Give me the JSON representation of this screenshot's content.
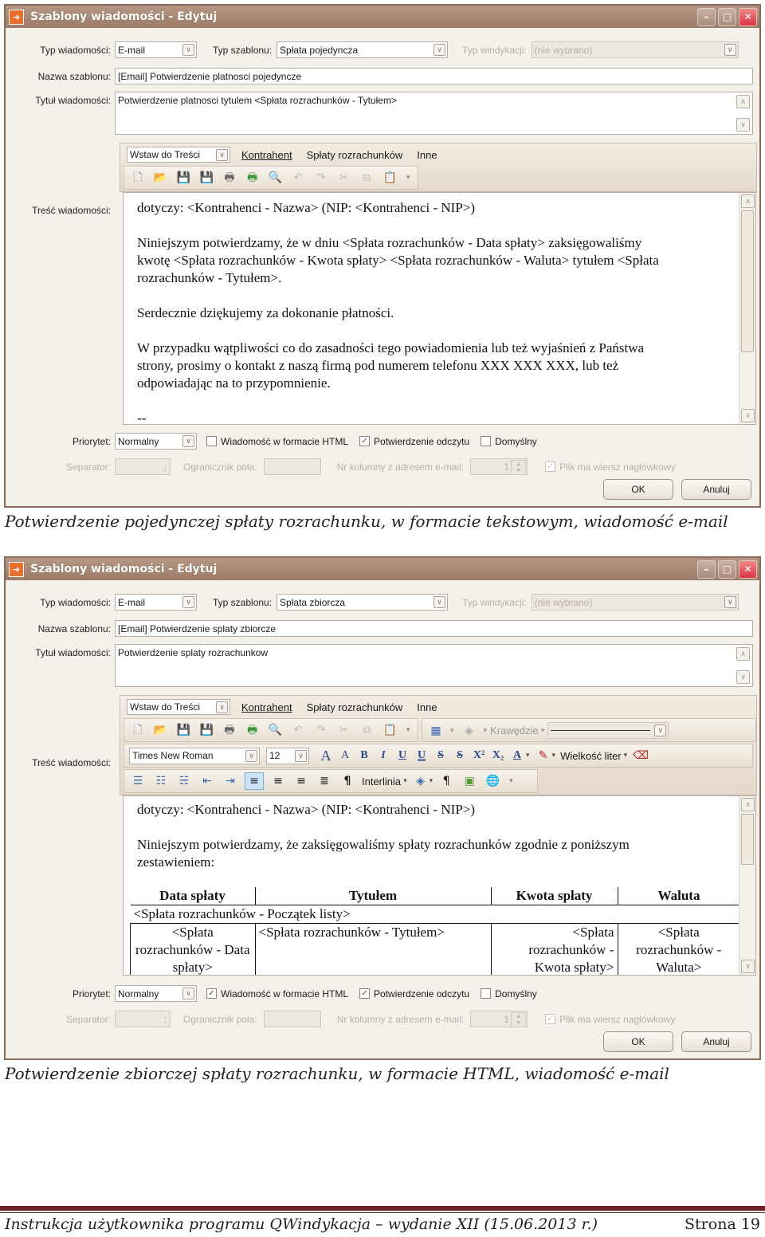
{
  "windows": [
    {
      "title": "Szablony wiadomości - Edytuj",
      "typ_wiadomosci_label": "Typ wiadomości:",
      "typ_wiadomosci_value": "E-mail",
      "typ_szablonu_label": "Typ szablonu:",
      "typ_szablonu_value": "Spłata pojedyncza",
      "typ_windykacji_label": "Typ windykacji:",
      "typ_windykacji_value": "(nie wybrano)",
      "nazwa_label": "Nazwa szablonu:",
      "nazwa_value": "[Email] Potwierdzenie platnosci pojedyncze",
      "tytul_label": "Tytuł wiadomości:",
      "tytul_value": "Potwierdzenie platnosci tytulem <Spłata rozrachunków - Tytułem>",
      "tresc_label": "Treść wiadomości:",
      "menu": {
        "insert": "Wstaw do Treści",
        "items": [
          "Kontrahent",
          "Spłaty rozrachunków",
          "Inne"
        ]
      },
      "body": [
        "dotyczy: <Kontrahenci - Nazwa> (NIP: <Kontrahenci - NIP>)",
        "",
        "Niniejszym potwierdzamy, że w dniu <Spłata rozrachunków - Data spłaty> zaksięgowaliśmy",
        "kwotę <Spłata rozrachunków - Kwota spłaty> <Spłata rozrachunków - Waluta> tytułem <Spłata",
        "rozrachunków - Tytułem>.",
        "",
        "Serdecznie dziękujemy za dokonanie płatności.",
        "",
        "W przypadku wątpliwości co do zasadności tego powiadomienia lub też wyjaśnień z Państwa",
        "strony, prosimy o kontakt z naszą firmą pod numerem telefonu XXX XXX XXX, lub też",
        "odpowiadając na to przypomnienie.",
        "",
        "--"
      ],
      "priorytet_label": "Priorytet:",
      "priorytet_value": "Normalny",
      "html_label": "Wiadomość w formacie HTML",
      "html_checked": false,
      "odczyt_label": "Potwierdzenie odczytu",
      "odczyt_checked": true,
      "domyslny_label": "Domyślny",
      "domyslny_checked": false,
      "separator_label": "Separator:",
      "separator_value": ";",
      "ogranicznik_label": "Ogranicznik pola:",
      "nr_kol_label": "Nr kolumny z adresem e-mail:",
      "nr_kol_value": "1",
      "naglowek_label": "Plik ma wiersz nagłówkowy",
      "naglowek_checked": true,
      "ok": "OK",
      "cancel": "Anuluj",
      "caption": "Potwierdzenie pojedynczej spłaty rozrachunku, w formacie tekstowym, wiadomość e-mail"
    },
    {
      "title": "Szablony wiadomości - Edytuj",
      "typ_wiadomosci_label": "Typ wiadomości:",
      "typ_wiadomosci_value": "E-mail",
      "typ_szablonu_label": "Typ szablonu:",
      "typ_szablonu_value": "Spłata zbiorcza",
      "typ_windykacji_label": "Typ windykacji:",
      "typ_windykacji_value": "(nie wybrano)",
      "nazwa_label": "Nazwa szablonu:",
      "nazwa_value": "[Email] Potwierdzenie splaty zbiorcze",
      "tytul_label": "Tytuł wiadomości:",
      "tytul_value": "Potwierdzenie splaty rozrachunkow",
      "tresc_label": "Treść wiadomości:",
      "menu": {
        "insert": "Wstaw do Treści",
        "items": [
          "Kontrahent",
          "Spłaty rozrachunków",
          "Inne"
        ]
      },
      "toolbar": {
        "krawedzie": "Krawędzie",
        "font": "Times New Roman",
        "size": "12",
        "wielkosc": "Wielkość liter",
        "interlinia": "Interlinia"
      },
      "body": [
        "dotyczy: <Kontrahenci - Nazwa> (NIP: <Kontrahenci - NIP>)",
        "",
        "Niniejszym potwierdzamy, że zaksięgowaliśmy spłaty rozrachunków zgodnie z poniższym",
        "zestawieniem:"
      ],
      "table": {
        "headers": [
          "Data spłaty",
          "Tytułem",
          "Kwota spłaty",
          "Waluta"
        ],
        "list_start": "<Spłata rozrachunków - Początek listy>",
        "row": [
          "<Spłata rozrachunków - Data spłaty>",
          "<Spłata rozrachunków - Tytułem>",
          "<Spłata rozrachunków - Kwota spłaty>",
          "<Spłata rozrachunków - Waluta>"
        ]
      },
      "priorytet_label": "Priorytet:",
      "priorytet_value": "Normalny",
      "html_label": "Wiadomość w formacie HTML",
      "html_checked": true,
      "odczyt_label": "Potwierdzenie odczytu",
      "odczyt_checked": true,
      "domyslny_label": "Domyślny",
      "domyslny_checked": false,
      "separator_label": "Separator:",
      "separator_value": ";",
      "ogranicznik_label": "Ogranicznik pola:",
      "nr_kol_label": "Nr kolumny z adresem e-mail:",
      "nr_kol_value": "1",
      "naglowek_label": "Plik ma wiersz nagłówkowy",
      "naglowek_checked": true,
      "ok": "OK",
      "cancel": "Anuluj",
      "caption": "Potwierdzenie zbiorczej spłaty rozrachunku, w formacie HTML, wiadomość e-mail"
    }
  ],
  "footer": {
    "left": "Instrukcja użytkownika programu QWindykacja – wydanie XII (15.06.2013 r.)",
    "right": "Strona 19"
  }
}
